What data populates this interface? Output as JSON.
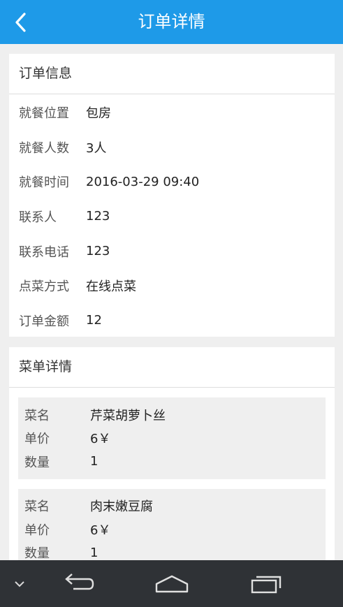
{
  "header": {
    "title": "订单详情",
    "back_icon": "chevron-left-icon"
  },
  "order_info": {
    "title": "订单信息",
    "rows": [
      {
        "label": "就餐位置",
        "value": "包房"
      },
      {
        "label": "就餐人数",
        "value": "3人"
      },
      {
        "label": "就餐时间",
        "value": "2016-03-29 09:40"
      },
      {
        "label": "联系人",
        "value": "123"
      },
      {
        "label": "联系电话",
        "value": "123"
      },
      {
        "label": "点菜方式",
        "value": "在线点菜"
      },
      {
        "label": "订单金额",
        "value": "12"
      }
    ]
  },
  "dish_details": {
    "title": "菜单详情",
    "dishes": [
      {
        "name_label": "菜名",
        "name": "芹菜胡萝卜丝",
        "price_label": "单价",
        "price": "6￥",
        "qty_label": "数量",
        "qty": "1"
      },
      {
        "name_label": "菜名",
        "name": "肉末嫩豆腐",
        "price_label": "单价",
        "price": "6￥",
        "qty_label": "数量",
        "qty": "1"
      }
    ]
  },
  "navbar": {
    "icons": [
      "chevron-down-icon",
      "back-icon",
      "home-icon",
      "recent-apps-icon"
    ]
  },
  "colors": {
    "header_bg": "#1e9ae8",
    "page_bg": "#efefef",
    "navbar_bg": "#2f3236"
  }
}
